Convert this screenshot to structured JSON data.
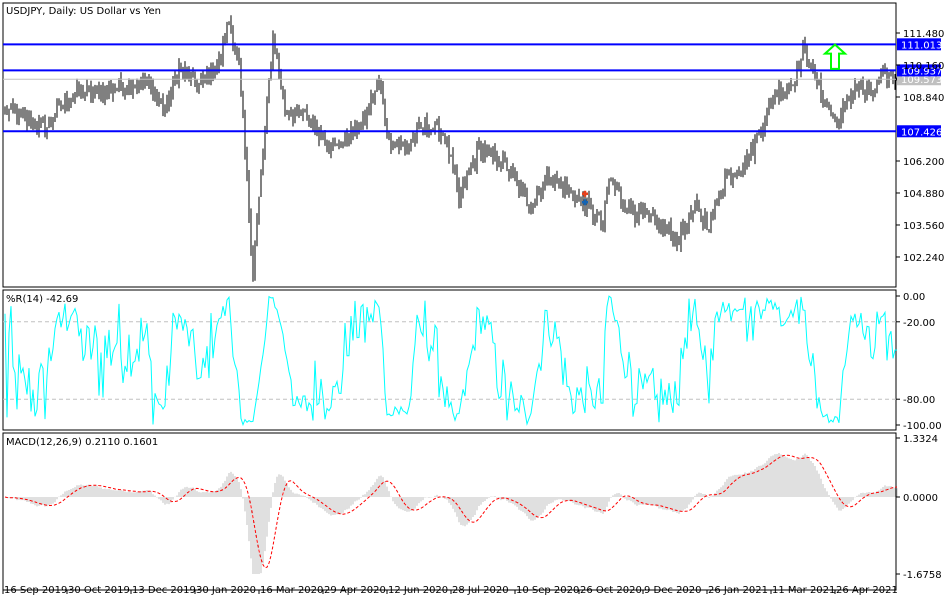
{
  "window": {
    "title": "USDJPY, Daily:  US Dollar vs Yen"
  },
  "colors": {
    "bars": "#000000",
    "level_line": "#0000ff",
    "level_label_bg": "#0000ff",
    "bid_line": "#c0c0c0",
    "wpr_line": "#00ffff",
    "macd_hist": "#c0c0c0",
    "macd_signal": "#ff0000",
    "arrow": "#00ff00"
  },
  "chart_data": {
    "type": "ohlc",
    "symbol": "USDJPY",
    "timeframe": "Daily",
    "price_ticks": [
      "111.480",
      "110.160",
      "108.840",
      "106.200",
      "104.880",
      "103.560",
      "102.240"
    ],
    "price_tick_values": [
      111.48,
      110.16,
      108.84,
      106.2,
      104.88,
      103.56,
      102.24
    ],
    "levels": [
      {
        "label": "111.013",
        "value": 111.013
      },
      {
        "label": "109.937",
        "value": 109.937
      },
      {
        "label": "107.426",
        "value": 107.426
      }
    ],
    "bid": {
      "label": "109.573",
      "value": 109.573
    },
    "bars_count": 447,
    "close_waypoints": [
      [
        0,
        108.3
      ],
      [
        20,
        107.5
      ],
      [
        32,
        108.9
      ],
      [
        50,
        109.1
      ],
      [
        70,
        109.5
      ],
      [
        80,
        108.3
      ],
      [
        87,
        110.0
      ],
      [
        97,
        109.3
      ],
      [
        107,
        110.2
      ],
      [
        112,
        112.0
      ],
      [
        117,
        110.0
      ],
      [
        124,
        101.7
      ],
      [
        130,
        107.5
      ],
      [
        134,
        111.4
      ],
      [
        140,
        108.3
      ],
      [
        150,
        108.1
      ],
      [
        165,
        106.7
      ],
      [
        180,
        107.9
      ],
      [
        187,
        109.5
      ],
      [
        192,
        107.1
      ],
      [
        200,
        106.7
      ],
      [
        210,
        107.7
      ],
      [
        220,
        107.3
      ],
      [
        227,
        104.6
      ],
      [
        237,
        106.7
      ],
      [
        250,
        106.1
      ],
      [
        262,
        104.4
      ],
      [
        272,
        105.6
      ],
      [
        290,
        104.4
      ],
      [
        299,
        103.6
      ],
      [
        302,
        105.5
      ],
      [
        310,
        104.4
      ],
      [
        325,
        103.6
      ],
      [
        337,
        103.0
      ],
      [
        345,
        104.2
      ],
      [
        352,
        103.6
      ],
      [
        360,
        105.5
      ],
      [
        372,
        106.3
      ],
      [
        380,
        108.0
      ],
      [
        385,
        109.0
      ],
      [
        392,
        109.2
      ],
      [
        400,
        110.8
      ],
      [
        407,
        109.2
      ],
      [
        416,
        107.7
      ],
      [
        425,
        109.3
      ],
      [
        432,
        108.9
      ],
      [
        440,
        109.7
      ],
      [
        446,
        109.573
      ]
    ],
    "dates": [
      "16 Sep 2019",
      "30 Oct 2019",
      "13 Dec 2019",
      "30 Jan 2020",
      "16 Mar 2020",
      "29 Apr 2020",
      "12 Jun 2020",
      "28 Jul 2020",
      "10 Sep 2020",
      "26 Oct 2020",
      "9 Dec 2020",
      "26 Jan 2021",
      "11 Mar 2021",
      "26 Apr 2021"
    ],
    "date_bar_index": [
      0,
      32,
      64,
      96,
      128,
      160,
      192,
      224,
      256,
      288,
      320,
      352,
      384,
      416
    ],
    "trade_markers": [
      {
        "type": "sell",
        "bar": 290,
        "price": 104.85
      },
      {
        "type": "buy",
        "bar": 290,
        "price": 104.5
      }
    ],
    "arrow_annotation": {
      "direction": "up",
      "bar": 415,
      "from_price": 110.0,
      "to_price": 111.0
    }
  },
  "wpr": {
    "label": "%R(14) -42.69",
    "period": 14,
    "ticks": [
      "0.00",
      "-20.00",
      "-80.00",
      "-100.00"
    ],
    "tick_values": [
      0,
      -20,
      -80,
      -100
    ],
    "levels": [
      -20,
      -80
    ]
  },
  "macd": {
    "label": "MACD(12,26,9) 0.2110 0.1601",
    "params": [
      12,
      26,
      9
    ],
    "ticks": [
      "1.3324",
      "0.0000",
      "-1.6758"
    ],
    "tick_values": [
      1.3324,
      0,
      -1.6758
    ]
  }
}
